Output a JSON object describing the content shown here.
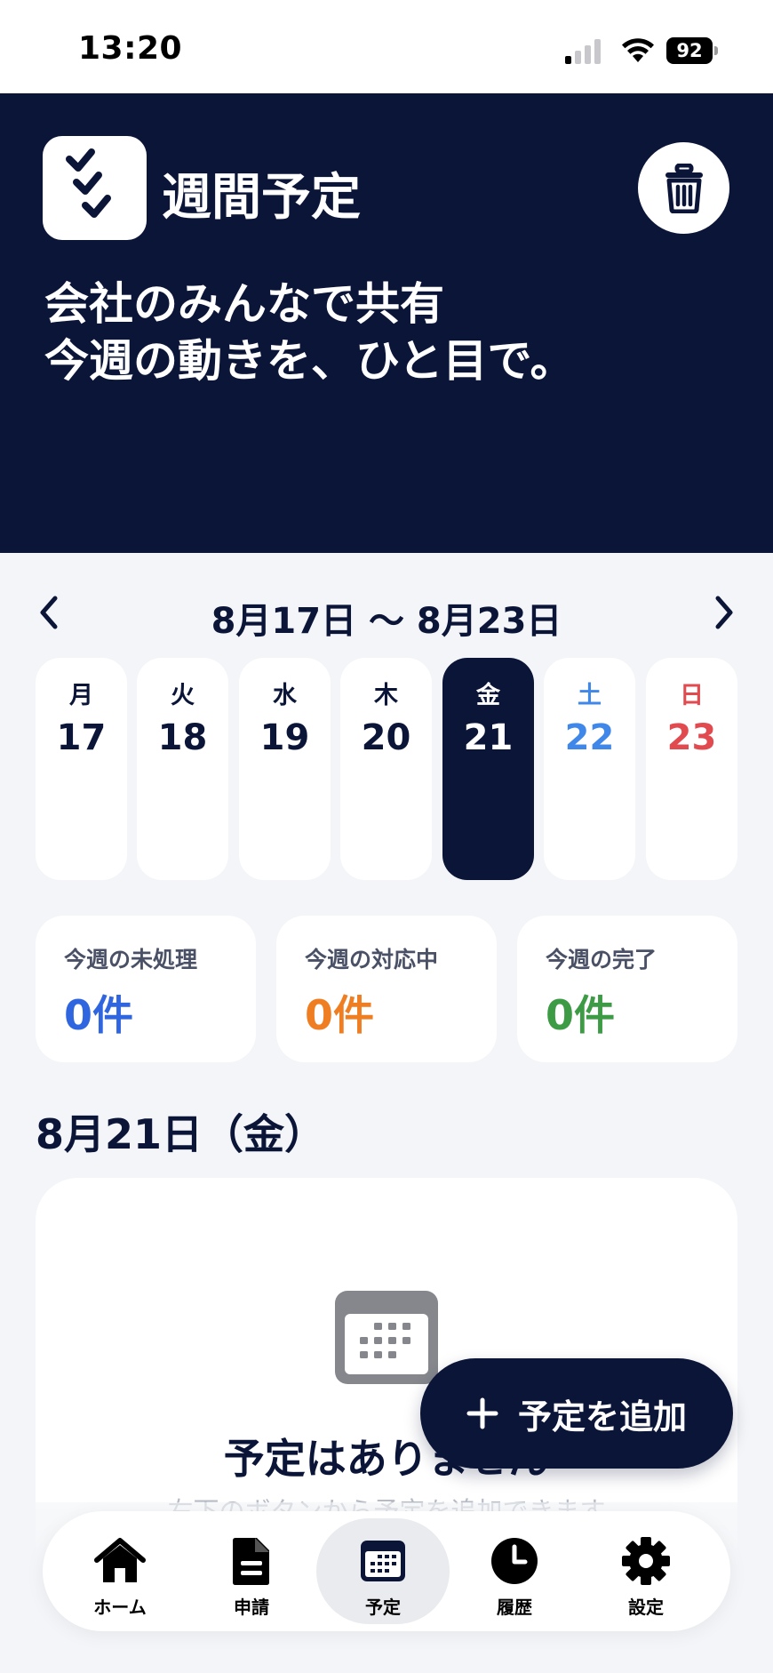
{
  "status_bar": {
    "time": "13:20",
    "battery": "92"
  },
  "header": {
    "app_title": "週間予定",
    "tagline_line1": "会社のみんなで共有",
    "tagline_line2": "今週の動きを、ひと目で。"
  },
  "week": {
    "range": "8月17日 〜 8月23日",
    "days": [
      {
        "dow": "月",
        "num": "17",
        "selected": false
      },
      {
        "dow": "火",
        "num": "18",
        "selected": false
      },
      {
        "dow": "水",
        "num": "19",
        "selected": false
      },
      {
        "dow": "木",
        "num": "20",
        "selected": false
      },
      {
        "dow": "金",
        "num": "21",
        "selected": true
      },
      {
        "dow": "土",
        "num": "22",
        "selected": false
      },
      {
        "dow": "日",
        "num": "23",
        "selected": false
      }
    ]
  },
  "stats": [
    {
      "label": "今週の未処理",
      "value": "0件",
      "color": "#2f66e0"
    },
    {
      "label": "今週の対応中",
      "value": "0件",
      "color": "#ef7d22"
    },
    {
      "label": "今週の完了",
      "value": "0件",
      "color": "#3d9a45"
    }
  ],
  "selected_date_heading": "8月21日（金）",
  "empty_state": {
    "title": "予定はありません",
    "subtitle": "右下のボタンから予定を追加できます"
  },
  "fab": {
    "label": "予定を追加"
  },
  "tabbar": [
    {
      "label": "ホーム",
      "icon": "home-icon",
      "active": false
    },
    {
      "label": "申請",
      "icon": "document-icon",
      "active": false
    },
    {
      "label": "予定",
      "icon": "calendar-icon",
      "active": true
    },
    {
      "label": "履歴",
      "icon": "clock-icon",
      "active": false
    },
    {
      "label": "設定",
      "icon": "gear-icon",
      "active": false
    }
  ],
  "colors": {
    "primary": "#0b1538",
    "saturday": "#3f87e8",
    "sunday": "#e14a4f",
    "background": "#f3f5f8"
  }
}
